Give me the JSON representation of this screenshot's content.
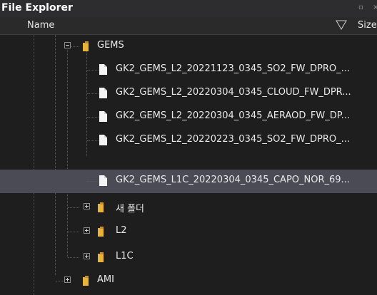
{
  "window": {
    "title": "File Explorer",
    "controls": [
      "▫",
      "×"
    ]
  },
  "columns": {
    "name": "Name",
    "size": "Size",
    "filter_icon": "filter-icon"
  },
  "tree": {
    "gems_folder": "GEMS",
    "gems_files": [
      "GK2_GEMS_L2_20221123_0345_SO2_FW_DPRO_...",
      "GK2_GEMS_L2_20220304_0345_CLOUD_FW_DPR...",
      "GK2_GEMS_L2_20220304_0345_AERAOD_FW_DP...",
      "GK2_GEMS_L2_20220223_0345_SO2_FW_DPRO_...",
      "GK2_GEMS_L1C_20220304_0345_CAPO_NOR_69..."
    ],
    "subfolders": [
      "새 폴더",
      "L2",
      "L1C"
    ],
    "ami_folder": "AMI",
    "selected_index": 4
  },
  "colors": {
    "folder": "#e8b339",
    "selected_row": "#4b4b55",
    "background": "#1e1e1e"
  }
}
